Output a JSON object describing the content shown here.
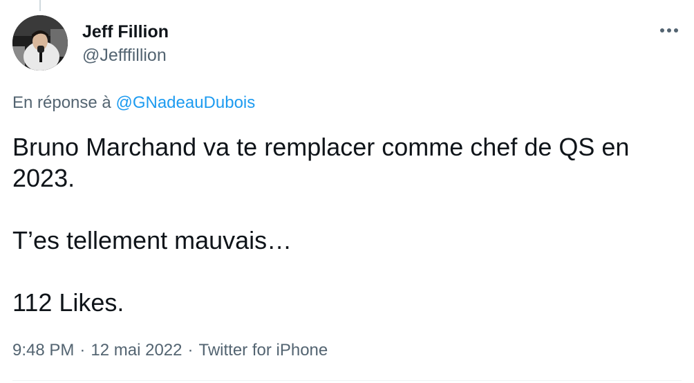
{
  "author": {
    "display_name": "Jeff Fillion",
    "handle": "@Jefffillion"
  },
  "reply_context": {
    "prefix": "En réponse à",
    "mention": "@GNadeauDubois"
  },
  "tweet": {
    "line1": "Bruno Marchand va te remplacer comme chef de QS en 2023.",
    "line2": "T’es tellement mauvais…",
    "line3": "112 Likes."
  },
  "meta": {
    "time": "9:48 PM",
    "separator": "·",
    "date": "12 mai 2022",
    "source": "Twitter for iPhone"
  },
  "icons": {
    "more": "more-horizontal-icon"
  },
  "colors": {
    "text_primary": "#0f1419",
    "text_secondary": "#536471",
    "link": "#1d9bf0",
    "divider": "#eff3f4"
  }
}
